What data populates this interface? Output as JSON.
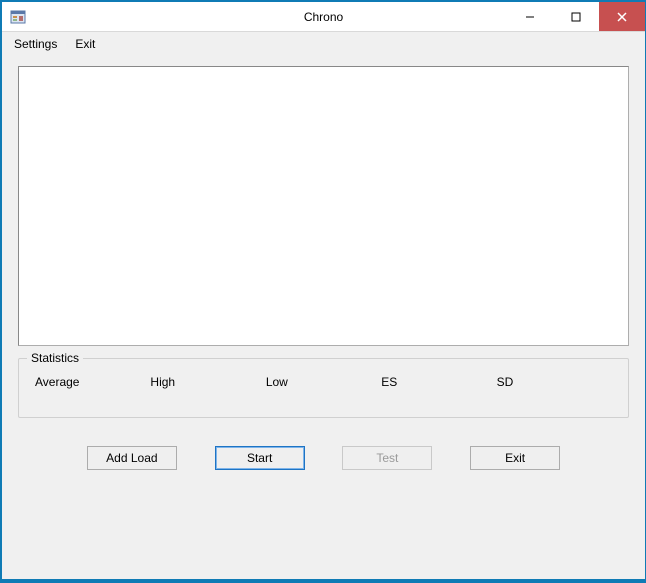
{
  "window": {
    "title": "Chrono"
  },
  "menu": {
    "settings": "Settings",
    "exit": "Exit"
  },
  "main": {
    "text_content": ""
  },
  "statistics": {
    "legend": "Statistics",
    "labels": {
      "average": "Average",
      "high": "High",
      "low": "Low",
      "es": "ES",
      "sd": "SD"
    }
  },
  "buttons": {
    "add_load": "Add Load",
    "start": "Start",
    "test": "Test",
    "exit": "Exit"
  }
}
